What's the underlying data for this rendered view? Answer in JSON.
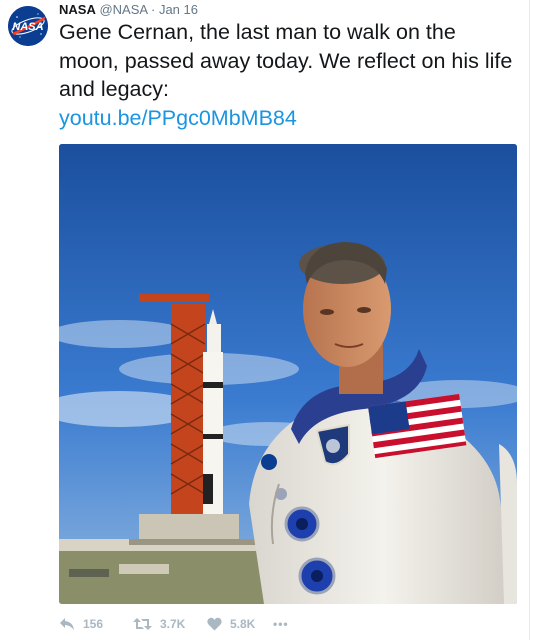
{
  "tweet": {
    "author_name": "NASA",
    "author_handle": "@NASA",
    "separator": "·",
    "date": "Jan 16",
    "avatar_logo_text": "NASA",
    "text": "Gene Cernan, the last man to walk on the moon, passed away today. We reflect on his life and legacy:",
    "link": "youtu.be/PPgc0MbMB84"
  },
  "photo": {
    "description_icon": "photo-of-astronaut-with-rocket"
  },
  "actions": {
    "reply_count": "156",
    "retweet_count": "3.7K",
    "like_count": "5.8K",
    "more_label": "•••"
  },
  "colors": {
    "link": "#1b95e0",
    "text": "#14171a",
    "meta": "#657786",
    "action": "#aab8c2",
    "nasa_blue": "#0b3d91",
    "nasa_red": "#fc3d21"
  }
}
